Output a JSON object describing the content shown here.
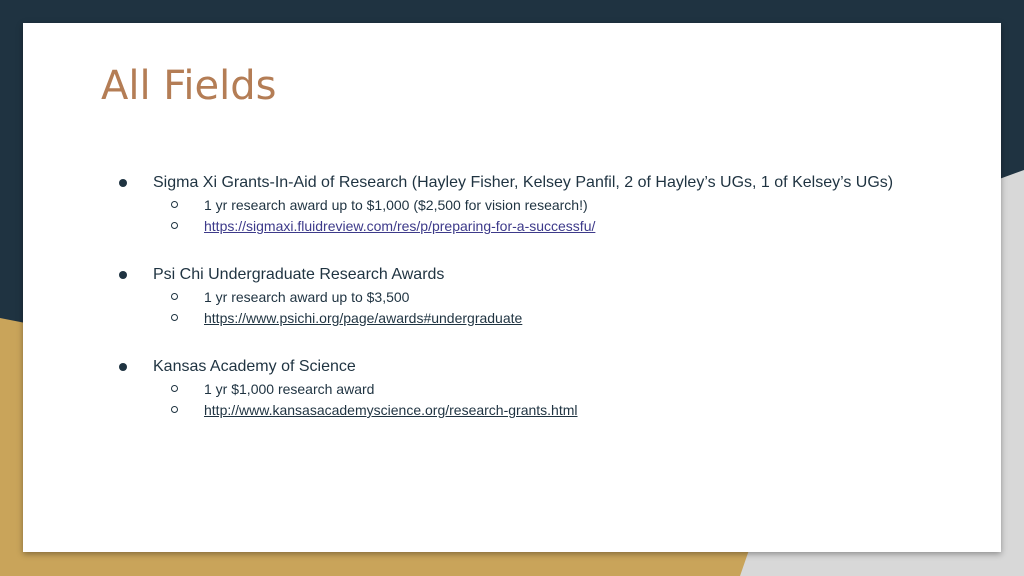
{
  "slide": {
    "title": "All Fields",
    "items": [
      {
        "label": "Sigma Xi Grants-In-Aid of Research (Hayley Fisher, Kelsey Panfil, 2 of Hayley’s UGs, 1 of Kelsey’s UGs)",
        "sub": [
          {
            "text": "1 yr research award up to $1,000 ($2,500 for vision research!)"
          },
          {
            "link": "https://sigmaxi.fluidreview.com/res/p/preparing-for-a-successfu/"
          }
        ]
      },
      {
        "label": "Psi Chi Undergraduate Research Awards",
        "sub": [
          {
            "text": "1 yr research award up to $3,500"
          },
          {
            "link": "https://www.psichi.org/page/awards#undergraduate"
          }
        ]
      },
      {
        "label": "Kansas Academy of Science",
        "sub": [
          {
            "text": "1 yr $1,000 research award"
          },
          {
            "link": "http://www.kansasacademyscience.org/research-grants.html"
          }
        ]
      }
    ]
  },
  "colors": {
    "title": "#b47d55",
    "text": "#1f3341",
    "background_dark": "#1f3341",
    "background_gold": "#c9a45a",
    "background_gray": "#d8d8d8"
  }
}
